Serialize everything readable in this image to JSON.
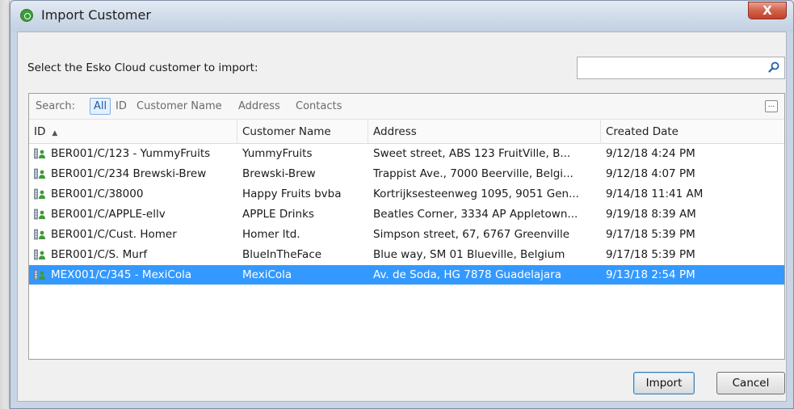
{
  "window": {
    "title": "Import Customer",
    "close_label": "X"
  },
  "dialog": {
    "prompt": "Select the Esko Cloud customer to import:",
    "search_value": ""
  },
  "search_options": {
    "label": "Search:",
    "options": [
      "All",
      "ID",
      "Customer Name",
      "Address",
      "Contacts"
    ],
    "selected": "All",
    "more_label": "..."
  },
  "table": {
    "columns": [
      "ID",
      "Customer Name",
      "Address",
      "Created Date"
    ],
    "sort_column": "ID",
    "sort_indicator": "▲",
    "rows": [
      {
        "id": "BER001/C/123 - YummyFruits",
        "name": "YummyFruits",
        "address": "Sweet street, ABS 123 FruitVille, B...",
        "created": "9/12/18 4:24 PM"
      },
      {
        "id": "BER001/C/234 Brewski-Brew",
        "name": "Brewski-Brew",
        "address": "Trappist Ave., 7000 Beerville, Belgi...",
        "created": "9/12/18 4:07 PM"
      },
      {
        "id": "BER001/C/38000",
        "name": "Happy Fruits bvba",
        "address": "Kortrijksesteenweg 1095, 9051 Gen...",
        "created": "9/14/18 11:41 AM"
      },
      {
        "id": "BER001/C/APPLE-ellv",
        "name": "APPLE Drinks",
        "address": "Beatles Corner, 3334 AP Appletown...",
        "created": "9/19/18 8:39 AM"
      },
      {
        "id": "BER001/C/Cust. Homer",
        "name": "Homer ltd.",
        "address": "Simpson street, 67, 6767 Greenville",
        "created": "9/17/18 5:39 PM"
      },
      {
        "id": "BER001/C/S. Murf",
        "name": "BlueInTheFace",
        "address": "Blue way, SM 01 Blueville, Belgium",
        "created": "9/17/18 5:39 PM"
      },
      {
        "id": "MEX001/C/345 - MexiCola",
        "name": "MexiCola",
        "address": "Av. de Soda, HG 7878 Guadelajara",
        "created": "9/13/18 2:54 PM"
      }
    ],
    "selected_row": 6
  },
  "buttons": {
    "import": "Import",
    "cancel": "Cancel"
  },
  "colors": {
    "selection": "#3399ff",
    "title_bar": "#cfdbe9",
    "close_button": "#c9472f",
    "customer_icon": "#3d9a3b"
  }
}
